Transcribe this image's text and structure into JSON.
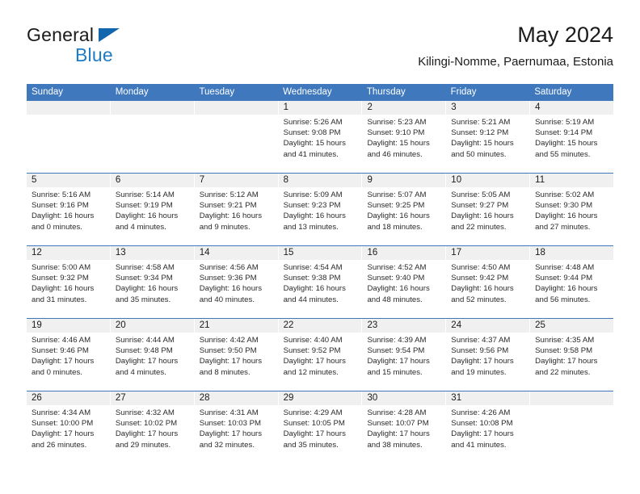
{
  "branding": {
    "logo_word1": "General",
    "logo_word2": "Blue",
    "logo_triangle_icon": "triangle-icon",
    "logo_color": "#1e7bc4"
  },
  "header": {
    "title": "May 2024",
    "subtitle": "Kilingi-Nomme, Paernumaa, Estonia"
  },
  "theme": {
    "header_blue": "#3f78bd",
    "day_band_gray": "#f0f0f0",
    "text": "#1b1b1b"
  },
  "calendar": {
    "weekdays": [
      "Sunday",
      "Monday",
      "Tuesday",
      "Wednesday",
      "Thursday",
      "Friday",
      "Saturday"
    ],
    "labels": {
      "sunrise": "Sunrise:",
      "sunset": "Sunset:",
      "daylight": "Daylight:"
    },
    "weeks": [
      [
        {
          "day": "",
          "empty": true
        },
        {
          "day": "",
          "empty": true
        },
        {
          "day": "",
          "empty": true
        },
        {
          "day": "1",
          "sunrise": "Sunrise: 5:26 AM",
          "sunset": "Sunset: 9:08 PM",
          "daylight_1": "Daylight: 15 hours",
          "daylight_2": "and 41 minutes."
        },
        {
          "day": "2",
          "sunrise": "Sunrise: 5:23 AM",
          "sunset": "Sunset: 9:10 PM",
          "daylight_1": "Daylight: 15 hours",
          "daylight_2": "and 46 minutes."
        },
        {
          "day": "3",
          "sunrise": "Sunrise: 5:21 AM",
          "sunset": "Sunset: 9:12 PM",
          "daylight_1": "Daylight: 15 hours",
          "daylight_2": "and 50 minutes."
        },
        {
          "day": "4",
          "sunrise": "Sunrise: 5:19 AM",
          "sunset": "Sunset: 9:14 PM",
          "daylight_1": "Daylight: 15 hours",
          "daylight_2": "and 55 minutes."
        }
      ],
      [
        {
          "day": "5",
          "sunrise": "Sunrise: 5:16 AM",
          "sunset": "Sunset: 9:16 PM",
          "daylight_1": "Daylight: 16 hours",
          "daylight_2": "and 0 minutes."
        },
        {
          "day": "6",
          "sunrise": "Sunrise: 5:14 AM",
          "sunset": "Sunset: 9:19 PM",
          "daylight_1": "Daylight: 16 hours",
          "daylight_2": "and 4 minutes."
        },
        {
          "day": "7",
          "sunrise": "Sunrise: 5:12 AM",
          "sunset": "Sunset: 9:21 PM",
          "daylight_1": "Daylight: 16 hours",
          "daylight_2": "and 9 minutes."
        },
        {
          "day": "8",
          "sunrise": "Sunrise: 5:09 AM",
          "sunset": "Sunset: 9:23 PM",
          "daylight_1": "Daylight: 16 hours",
          "daylight_2": "and 13 minutes."
        },
        {
          "day": "9",
          "sunrise": "Sunrise: 5:07 AM",
          "sunset": "Sunset: 9:25 PM",
          "daylight_1": "Daylight: 16 hours",
          "daylight_2": "and 18 minutes."
        },
        {
          "day": "10",
          "sunrise": "Sunrise: 5:05 AM",
          "sunset": "Sunset: 9:27 PM",
          "daylight_1": "Daylight: 16 hours",
          "daylight_2": "and 22 minutes."
        },
        {
          "day": "11",
          "sunrise": "Sunrise: 5:02 AM",
          "sunset": "Sunset: 9:30 PM",
          "daylight_1": "Daylight: 16 hours",
          "daylight_2": "and 27 minutes."
        }
      ],
      [
        {
          "day": "12",
          "sunrise": "Sunrise: 5:00 AM",
          "sunset": "Sunset: 9:32 PM",
          "daylight_1": "Daylight: 16 hours",
          "daylight_2": "and 31 minutes."
        },
        {
          "day": "13",
          "sunrise": "Sunrise: 4:58 AM",
          "sunset": "Sunset: 9:34 PM",
          "daylight_1": "Daylight: 16 hours",
          "daylight_2": "and 35 minutes."
        },
        {
          "day": "14",
          "sunrise": "Sunrise: 4:56 AM",
          "sunset": "Sunset: 9:36 PM",
          "daylight_1": "Daylight: 16 hours",
          "daylight_2": "and 40 minutes."
        },
        {
          "day": "15",
          "sunrise": "Sunrise: 4:54 AM",
          "sunset": "Sunset: 9:38 PM",
          "daylight_1": "Daylight: 16 hours",
          "daylight_2": "and 44 minutes."
        },
        {
          "day": "16",
          "sunrise": "Sunrise: 4:52 AM",
          "sunset": "Sunset: 9:40 PM",
          "daylight_1": "Daylight: 16 hours",
          "daylight_2": "and 48 minutes."
        },
        {
          "day": "17",
          "sunrise": "Sunrise: 4:50 AM",
          "sunset": "Sunset: 9:42 PM",
          "daylight_1": "Daylight: 16 hours",
          "daylight_2": "and 52 minutes."
        },
        {
          "day": "18",
          "sunrise": "Sunrise: 4:48 AM",
          "sunset": "Sunset: 9:44 PM",
          "daylight_1": "Daylight: 16 hours",
          "daylight_2": "and 56 minutes."
        }
      ],
      [
        {
          "day": "19",
          "sunrise": "Sunrise: 4:46 AM",
          "sunset": "Sunset: 9:46 PM",
          "daylight_1": "Daylight: 17 hours",
          "daylight_2": "and 0 minutes."
        },
        {
          "day": "20",
          "sunrise": "Sunrise: 4:44 AM",
          "sunset": "Sunset: 9:48 PM",
          "daylight_1": "Daylight: 17 hours",
          "daylight_2": "and 4 minutes."
        },
        {
          "day": "21",
          "sunrise": "Sunrise: 4:42 AM",
          "sunset": "Sunset: 9:50 PM",
          "daylight_1": "Daylight: 17 hours",
          "daylight_2": "and 8 minutes."
        },
        {
          "day": "22",
          "sunrise": "Sunrise: 4:40 AM",
          "sunset": "Sunset: 9:52 PM",
          "daylight_1": "Daylight: 17 hours",
          "daylight_2": "and 12 minutes."
        },
        {
          "day": "23",
          "sunrise": "Sunrise: 4:39 AM",
          "sunset": "Sunset: 9:54 PM",
          "daylight_1": "Daylight: 17 hours",
          "daylight_2": "and 15 minutes."
        },
        {
          "day": "24",
          "sunrise": "Sunrise: 4:37 AM",
          "sunset": "Sunset: 9:56 PM",
          "daylight_1": "Daylight: 17 hours",
          "daylight_2": "and 19 minutes."
        },
        {
          "day": "25",
          "sunrise": "Sunrise: 4:35 AM",
          "sunset": "Sunset: 9:58 PM",
          "daylight_1": "Daylight: 17 hours",
          "daylight_2": "and 22 minutes."
        }
      ],
      [
        {
          "day": "26",
          "sunrise": "Sunrise: 4:34 AM",
          "sunset": "Sunset: 10:00 PM",
          "daylight_1": "Daylight: 17 hours",
          "daylight_2": "and 26 minutes."
        },
        {
          "day": "27",
          "sunrise": "Sunrise: 4:32 AM",
          "sunset": "Sunset: 10:02 PM",
          "daylight_1": "Daylight: 17 hours",
          "daylight_2": "and 29 minutes."
        },
        {
          "day": "28",
          "sunrise": "Sunrise: 4:31 AM",
          "sunset": "Sunset: 10:03 PM",
          "daylight_1": "Daylight: 17 hours",
          "daylight_2": "and 32 minutes."
        },
        {
          "day": "29",
          "sunrise": "Sunrise: 4:29 AM",
          "sunset": "Sunset: 10:05 PM",
          "daylight_1": "Daylight: 17 hours",
          "daylight_2": "and 35 minutes."
        },
        {
          "day": "30",
          "sunrise": "Sunrise: 4:28 AM",
          "sunset": "Sunset: 10:07 PM",
          "daylight_1": "Daylight: 17 hours",
          "daylight_2": "and 38 minutes."
        },
        {
          "day": "31",
          "sunrise": "Sunrise: 4:26 AM",
          "sunset": "Sunset: 10:08 PM",
          "daylight_1": "Daylight: 17 hours",
          "daylight_2": "and 41 minutes."
        },
        {
          "day": "",
          "empty": true
        }
      ]
    ]
  }
}
